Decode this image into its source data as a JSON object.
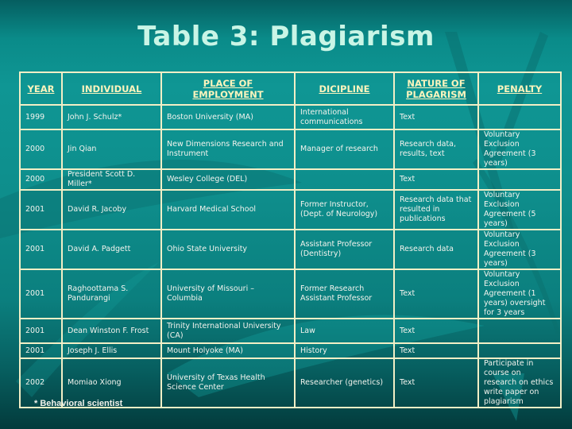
{
  "slide": {
    "title": "Table 3:  Plagiarism",
    "footnote": "* Behavioral scientist"
  },
  "table": {
    "headers": [
      "YEAR",
      "INDIVIDUAL",
      "PLACE OF EMPLOYMENT",
      "DICIPLINE",
      "NATURE OF PLAGARISM",
      "PENALTY"
    ],
    "rows": [
      [
        "1999",
        "John J. Schulz*",
        "Boston University (MA)",
        "International communications",
        "Text",
        ""
      ],
      [
        "2000",
        "Jin Qian",
        "New Dimensions Research and Instrument",
        "Manager of research",
        "Research data, results, text",
        "Voluntary Exclusion Agreement  (3 years)"
      ],
      [
        "2000",
        "President Scott D. Miller*",
        "Wesley College (DEL)",
        "",
        "Text",
        ""
      ],
      [
        "2001",
        "David R. Jacoby",
        "Harvard Medical School",
        "Former Instructor, (Dept. of Neurology)",
        "Research data that resulted in publications",
        "Voluntary Exclusion Agreement  (5 years)"
      ],
      [
        "2001",
        "David A. Padgett",
        "Ohio State University",
        "Assistant Professor (Dentistry)",
        "Research data",
        "Voluntary Exclusion Agreement  (3 years)"
      ],
      [
        "2001",
        "Raghoottama S. Pandurangi",
        "University of Missouri – Columbia",
        "Former Research Assistant Professor",
        "Text",
        "Voluntary Exclusion Agreement  (1 years) oversight for 3 years"
      ],
      [
        "2001",
        "Dean Winston F. Frost",
        "Trinity International University (CA)",
        "Law",
        "Text",
        ""
      ],
      [
        "2001",
        "Joseph J. Ellis",
        "Mount Holyoke (MA)",
        "History",
        "Text",
        ""
      ],
      [
        "2002",
        "Momiao Xiong",
        "University of Texas Health Science Center",
        "Researcher (genetics)",
        "Text",
        "Participate in course on research on ethics write paper on plagiarism"
      ]
    ]
  }
}
